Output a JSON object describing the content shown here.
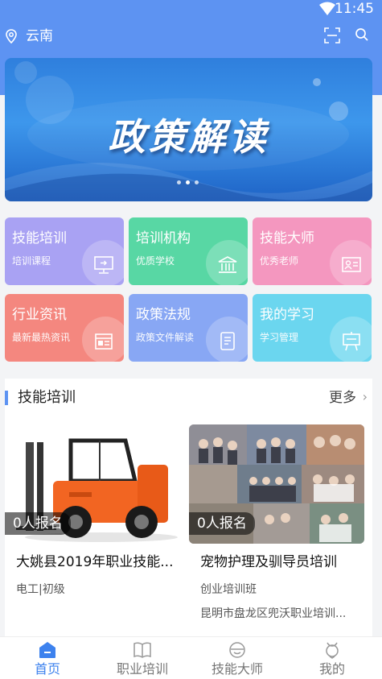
{
  "status": {
    "time": "11:45"
  },
  "topbar": {
    "location": "云南"
  },
  "banner": {
    "title": "政策解读",
    "dots": 3,
    "active_dot": 1
  },
  "grid": [
    {
      "title": "技能培训",
      "sub": "培训课程",
      "icon": "monitor-icon",
      "color": "#a9a2f3"
    },
    {
      "title": "培训机构",
      "sub": "优质学校",
      "icon": "building-icon",
      "color": "#58d7a4"
    },
    {
      "title": "技能大师",
      "sub": "优秀老师",
      "icon": "id-card-icon",
      "color": "#f497bf"
    },
    {
      "title": "行业资讯",
      "sub": "最新最热资讯",
      "icon": "newspaper-icon",
      "color": "#f4877f"
    },
    {
      "title": "政策法规",
      "sub": "政策文件解读",
      "icon": "document-icon",
      "color": "#88a7f4"
    },
    {
      "title": "我的学习",
      "sub": "学习管理",
      "icon": "easel-icon",
      "color": "#6bd6ef"
    }
  ],
  "section": {
    "title": "技能培训",
    "more": "更多",
    "cards": [
      {
        "badge": "0人报名",
        "title": "大姚县2019年职业技能...",
        "sub": "电工|初级",
        "org": ""
      },
      {
        "badge": "0人报名",
        "title": "宠物护理及驯导员培训",
        "sub": "创业培训班",
        "org": "昆明市盘龙区兜沃职业培训..."
      }
    ]
  },
  "tabs": [
    {
      "label": "首页",
      "icon": "home-icon"
    },
    {
      "label": "职业培训",
      "icon": "book-icon"
    },
    {
      "label": "技能大师",
      "icon": "master-icon"
    },
    {
      "label": "我的",
      "icon": "user-icon"
    }
  ],
  "colors": {
    "primary": "#5d93f2",
    "tab_active": "#3d82ee"
  }
}
